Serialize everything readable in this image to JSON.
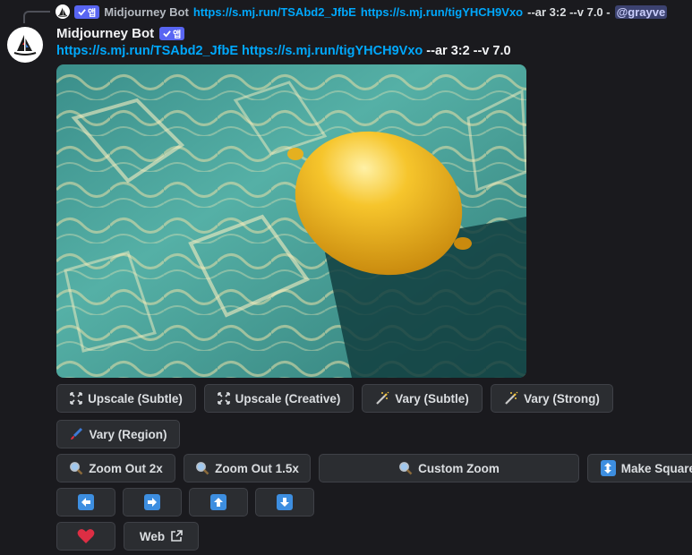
{
  "reply": {
    "bot_name": "Midjourney Bot",
    "badge": "앱",
    "link1": "https://s.mj.run/TSAbd2_JfbE",
    "link2": "https://s.mj.run/tigYHCH9Vxo",
    "params": "--ar 3:2 --v 7.0 -",
    "mention": "@grayve"
  },
  "message": {
    "username": "Midjourney Bot",
    "badge": "앱",
    "link1": "https://s.mj.run/TSAbd2_JfbE",
    "link2": "https://s.mj.run/tigYHCH9Vxo",
    "params": "--ar 3:2 --v 7.0"
  },
  "buttons": {
    "upscale_subtle": "Upscale (Subtle)",
    "upscale_creative": "Upscale (Creative)",
    "vary_subtle": "Vary (Subtle)",
    "vary_strong": "Vary (Strong)",
    "vary_region": "Vary (Region)",
    "zoom_out_2x": "Zoom Out 2x",
    "zoom_out_1_5x": "Zoom Out 1.5x",
    "custom_zoom": "Custom Zoom",
    "make_square": "Make Square",
    "web": "Web"
  },
  "icons": {
    "upscale": "expand-corners-icon",
    "vary": "magic-wand-icon",
    "region": "paintbrush-icon",
    "zoom": "magnifier-icon",
    "square": "up-down-arrow-icon",
    "pan_left": "arrow-left-icon",
    "pan_right": "arrow-right-icon",
    "pan_up": "arrow-up-icon",
    "pan_down": "arrow-down-icon",
    "like": "heart-icon",
    "external": "external-link-icon"
  },
  "colors": {
    "background": "#1a1a1e",
    "button_bg": "#2b2d31",
    "link": "#00a8fc",
    "badge": "#5865f2",
    "arrow_tile": "#3d8ee0",
    "heart": "#dd2e44",
    "lemon": "#f2b51c",
    "water": "#4aa7a0"
  }
}
